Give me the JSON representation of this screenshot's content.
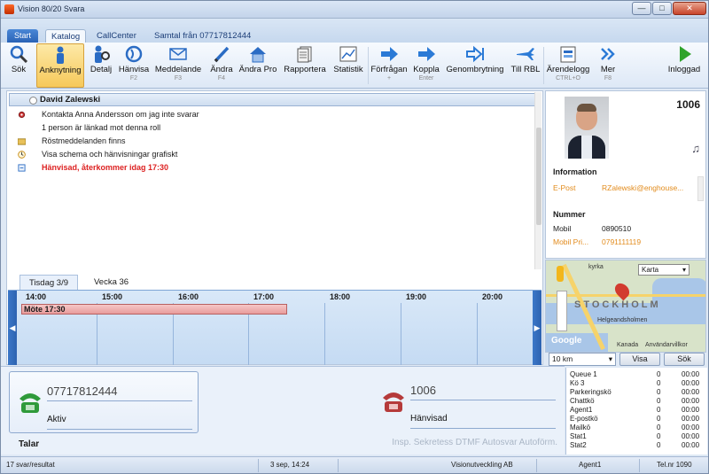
{
  "window": {
    "title": "Vision 80/20 Svara"
  },
  "tabs": {
    "start": "Start",
    "items": [
      "Katalog",
      "CallCenter",
      "Samtal från  07717812444"
    ]
  },
  "ribbon": [
    {
      "label": "Sök",
      "key": "",
      "icon": "search-icon"
    },
    {
      "label": "Anknytning",
      "key": "",
      "icon": "person-icon"
    },
    {
      "label": "Detalj",
      "key": "",
      "icon": "detail-icon"
    },
    {
      "label": "Hänvisa",
      "key": "F2",
      "icon": "redirect-icon"
    },
    {
      "label": "Meddelande",
      "key": "F3",
      "icon": "envelope-icon"
    },
    {
      "label": "Ändra",
      "key": "F4",
      "icon": "pen-icon"
    },
    {
      "label": "Ändra Pro",
      "key": "",
      "icon": "house-icon"
    },
    {
      "label": "Rapportera",
      "key": "",
      "icon": "report-icon"
    },
    {
      "label": "Statistik",
      "key": "",
      "icon": "statistics-icon"
    },
    {
      "label": "Förfrågan",
      "key": "+",
      "icon": "arrow-right-icon"
    },
    {
      "label": "Koppla",
      "key": "Enter",
      "icon": "arrow-right-icon"
    },
    {
      "label": "Genombrytning",
      "key": "",
      "icon": "breakthrough-icon"
    },
    {
      "label": "Till RBL",
      "key": "",
      "icon": "airplane-icon"
    },
    {
      "label": "Ärendelogg",
      "key": "CTRL+O",
      "icon": "log-icon"
    },
    {
      "label": "Mer",
      "key": "F8",
      "icon": "double-chevron-icon"
    },
    {
      "label": "Inloggad",
      "key": "",
      "icon": "play-icon"
    }
  ],
  "contact": {
    "name": "David Zalewski",
    "rows": [
      {
        "text": "Kontakta Anna Andersson om jag inte svarar",
        "icon": "gear-icon"
      },
      {
        "text": "1 person är länkad mot denna roll",
        "icon": ""
      },
      {
        "text": "Röstmeddelanden finns",
        "icon": "folder-icon"
      },
      {
        "text": "Visa schema och hänvisningar grafiskt",
        "icon": "clock-icon"
      },
      {
        "text": "Hänvisad, återkommer idag 17:30",
        "icon": "status-icon"
      }
    ]
  },
  "schedule": {
    "tabs": [
      "Tisdag 3/9",
      "Vecka 36"
    ],
    "times": [
      "14:00",
      "15:00",
      "16:00",
      "17:00",
      "18:00",
      "19:00",
      "20:00"
    ],
    "meeting": "Möte 17:30"
  },
  "profile": {
    "extension": "1006",
    "information_title": "Information",
    "email_label": "E-Post",
    "email_value": "RZalewski@enghouse...",
    "number_title": "Nummer",
    "mobile_label": "Mobil",
    "mobile_value": "0890510",
    "mobile_private_label": "Mobil Pri...",
    "mobile_private_value": "0791111119"
  },
  "map": {
    "mode": "Karta",
    "city": "STOCKHOLM",
    "labels": [
      "kyrka",
      "Helgeandsholmen",
      "Kanada",
      "Användarvillkor",
      "Google"
    ],
    "distance": "10 km",
    "show_button": "Visa",
    "search_button": "Sök"
  },
  "call": {
    "caller_number": "07717812444",
    "caller_status": "Aktiv",
    "target_number": "1006",
    "target_status": "Hänvisad",
    "talk_label": "Talar",
    "features": "Insp.  Sekretess  DTMF  Autosvar  Autoförm."
  },
  "queues": [
    {
      "name": "Queue 1",
      "count": "0",
      "time": "00:00"
    },
    {
      "name": "Kö 3",
      "count": "0",
      "time": "00:00"
    },
    {
      "name": "Parkeringskö",
      "count": "0",
      "time": "00:00"
    },
    {
      "name": "Chattkö",
      "count": "0",
      "time": "00:00"
    },
    {
      "name": "Agent1",
      "count": "0",
      "time": "00:00"
    },
    {
      "name": "E-postkö",
      "count": "0",
      "time": "00:00"
    },
    {
      "name": "Mailkö",
      "count": "0",
      "time": "00:00"
    },
    {
      "name": "Stat1",
      "count": "0",
      "time": "00:00"
    },
    {
      "name": "Stat2",
      "count": "0",
      "time": "00:00"
    }
  ],
  "status": {
    "results": "17 svar/resultat",
    "datetime": "3 sep, 14:24",
    "company": "Visionutveckling AB",
    "agent": "Agent1",
    "phone": "Tel.nr 1090"
  },
  "colors": {
    "accent": "#2a63b6",
    "selected": "#f6c95a",
    "meeting": "#e89c9c",
    "warning": "#d22222"
  }
}
